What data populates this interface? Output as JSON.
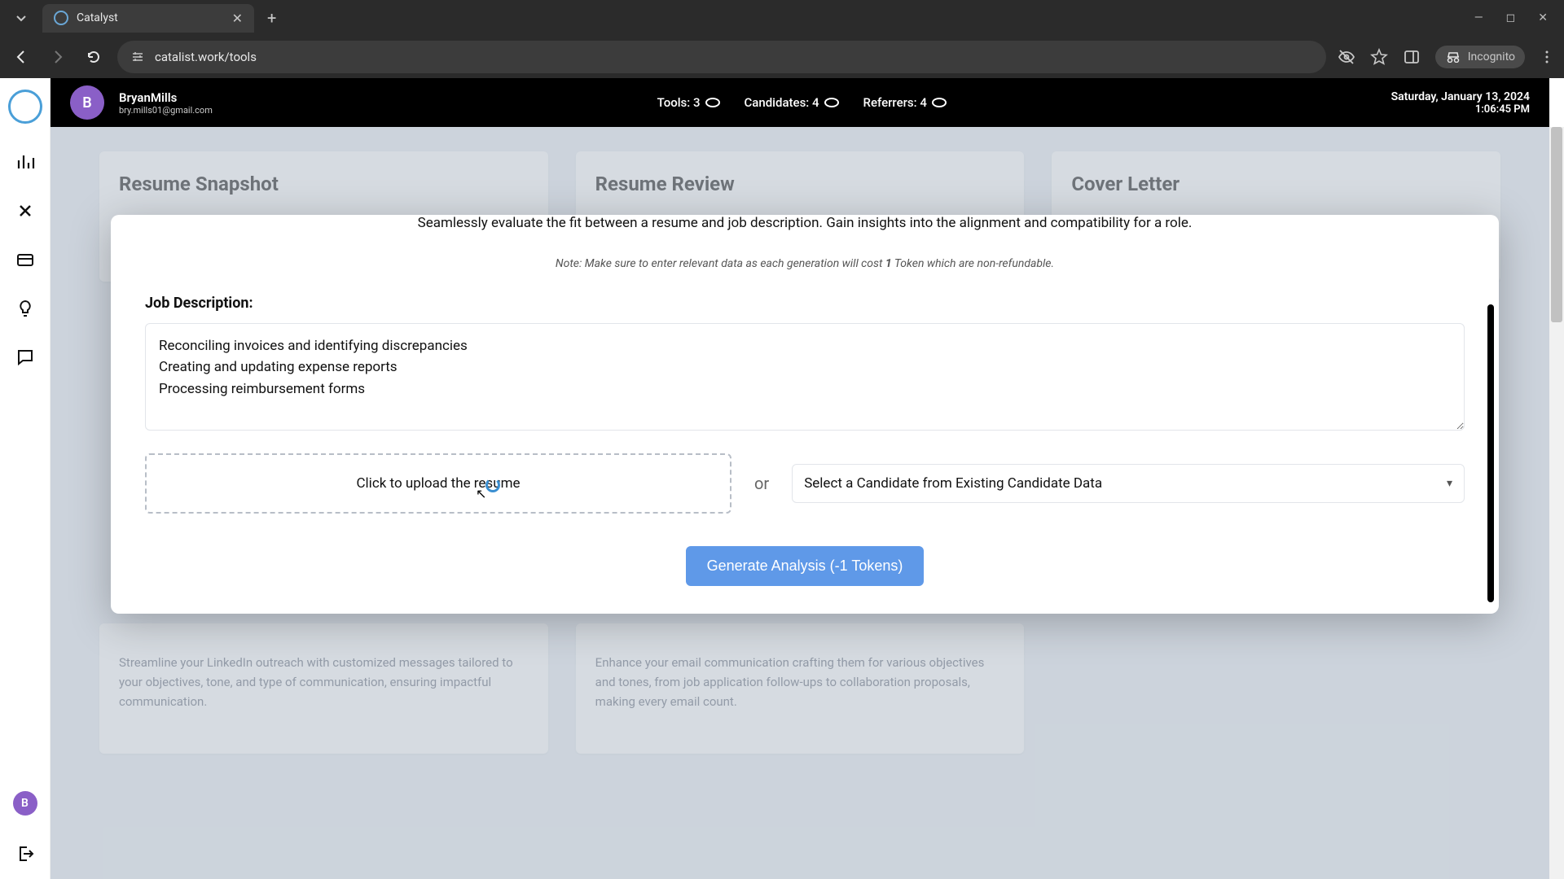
{
  "browser": {
    "tab_title": "Catalyst",
    "url": "catalist.work/tools",
    "incognito_label": "Incognito"
  },
  "header": {
    "avatar_initial": "B",
    "username": "BryanMills",
    "email": "bry.mills01@gmail.com",
    "stats": {
      "tools_label": "Tools: 3",
      "candidates_label": "Candidates: 4",
      "referrers_label": "Referrers: 4"
    },
    "date": "Saturday, January 13, 2024",
    "time": "1:06:45 PM"
  },
  "cards": {
    "resume_snapshot": "Resume Snapshot",
    "resume_review": "Resume Review",
    "cover_letter": "Cover Letter",
    "linkedin_desc": "Streamline your LinkedIn outreach with customized messages tailored to your objectives, tone, and type of communication, ensuring impactful communication.",
    "email_desc": "Enhance your email communication crafting them for various objectives and tones, from job application follow-ups to collaboration proposals, making every email count."
  },
  "modal": {
    "subtitle": "Seamlessly evaluate the fit between a resume and job description. Gain insights into the alignment and compatibility for a role.",
    "note_prefix": "Note: Make sure to enter relevant data as each generation will cost ",
    "note_count": "1",
    "note_suffix": " Token which are non-refundable.",
    "jd_label": "Job Description:",
    "jd_value": "Reconciling invoices and identifying discrepancies\nCreating and updating expense reports\nProcessing reimbursement forms",
    "upload_label": "Click to upload the resume",
    "or": "or",
    "select_placeholder": "Select a Candidate from Existing Candidate Data",
    "generate_label": "Generate Analysis (-1 Tokens)"
  },
  "rail": {
    "avatar_initial": "B"
  }
}
